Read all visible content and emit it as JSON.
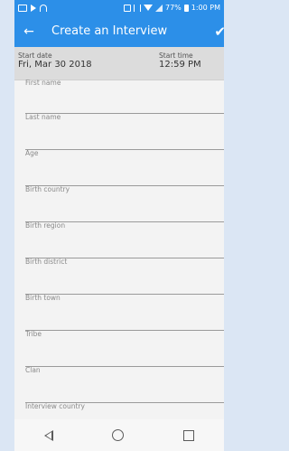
{
  "status_bar": {
    "battery_percent": "77%",
    "time": "1:00 PM",
    "icons": [
      "cast-icon",
      "play-icon",
      "wifi-icon",
      "nfc-icon",
      "vibrate-icon",
      "wifi-full-icon",
      "signal-icon",
      "battery-icon"
    ]
  },
  "app_bar": {
    "title": "Create an Interview",
    "back_icon": "back-arrow-icon",
    "action_icon": "check-icon",
    "color": "#2c8fe8"
  },
  "header": {
    "start_date_label": "Start date",
    "start_date_value": "Fri, Mar 30 2018",
    "start_time_label": "Start time",
    "start_time_value": "12:59 PM"
  },
  "form": {
    "fields": [
      {
        "label": "First name"
      },
      {
        "label": "Last name"
      },
      {
        "label": "Age"
      },
      {
        "label": "Birth country"
      },
      {
        "label": "Birth region"
      },
      {
        "label": "Birth district"
      },
      {
        "label": "Birth town"
      },
      {
        "label": "Tribe"
      },
      {
        "label": "Clan"
      },
      {
        "label": "Interview country"
      }
    ]
  },
  "nav_bar": {
    "icons": [
      "nav-back-icon",
      "nav-home-icon",
      "nav-recent-icon"
    ]
  }
}
